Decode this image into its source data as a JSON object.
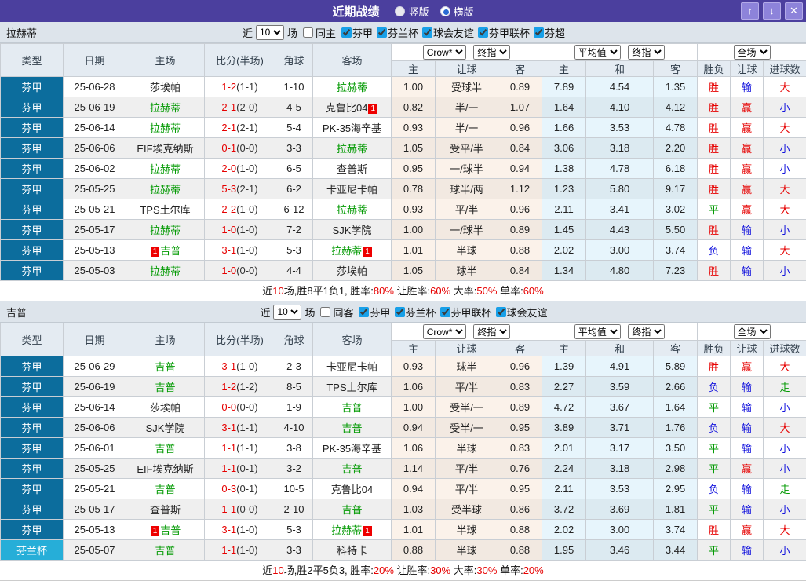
{
  "titlebar": {
    "title": "近期战绩",
    "radio_vertical": {
      "label": "竖版",
      "checked": false
    },
    "radio_horizontal": {
      "label": "横版",
      "checked": true
    },
    "buttons": {
      "up": "↑",
      "down": "↓",
      "close": "✕"
    }
  },
  "filter_labels": {
    "near": "近",
    "games": "场"
  },
  "columns": {
    "type": "类型",
    "date": "日期",
    "home": "主场",
    "score": "比分(半场)",
    "corner": "角球",
    "away": "客场",
    "sub": [
      "主",
      "让球",
      "客",
      "主",
      "和",
      "客",
      "胜负",
      "让球",
      "进球数"
    ],
    "selects": {
      "crow": "Crow*",
      "fin1": "终指",
      "avg": "平均值",
      "fin2": "终指",
      "full": "全场"
    }
  },
  "result_colors": {
    "胜": "c-r",
    "赢": "c-r",
    "大": "c-r",
    "平": "c-g",
    "走": "c-g",
    "负": "c-b",
    "输": "c-b",
    "小": "c-b"
  },
  "sections": [
    {
      "team": "拉赫蒂",
      "filter": {
        "count": "10",
        "same_label": "同主",
        "same_checked": false,
        "leagues": [
          "芬甲",
          "芬兰杯",
          "球会友谊",
          "芬甲联杯",
          "芬超"
        ]
      },
      "rows": [
        {
          "lg": "芬甲",
          "cup": false,
          "date": "25-06-28",
          "home": {
            "name": "莎埃帕"
          },
          "score": "1-2",
          "half": "(1-1)",
          "corner": "1-10",
          "away": {
            "name": "拉赫蒂",
            "green": true
          },
          "crow": [
            "1.00",
            "受球半",
            "0.89"
          ],
          "avg": [
            "7.89",
            "4.54",
            "1.35"
          ],
          "res": [
            "胜",
            "输",
            "大"
          ]
        },
        {
          "lg": "芬甲",
          "cup": false,
          "date": "25-06-19",
          "home": {
            "name": "拉赫蒂",
            "green": true
          },
          "score": "2-1",
          "half": "(2-0)",
          "corner": "4-5",
          "away": {
            "name": "克鲁比04",
            "badge_after": "1"
          },
          "crow": [
            "0.82",
            "半/一",
            "1.07"
          ],
          "avg": [
            "1.64",
            "4.10",
            "4.12"
          ],
          "res": [
            "胜",
            "赢",
            "小"
          ]
        },
        {
          "lg": "芬甲",
          "cup": false,
          "date": "25-06-14",
          "home": {
            "name": "拉赫蒂",
            "green": true
          },
          "score": "2-1",
          "half": "(2-1)",
          "corner": "5-4",
          "away": {
            "name": "PK-35海辛基"
          },
          "crow": [
            "0.93",
            "半/一",
            "0.96"
          ],
          "avg": [
            "1.66",
            "3.53",
            "4.78"
          ],
          "res": [
            "胜",
            "赢",
            "大"
          ]
        },
        {
          "lg": "芬甲",
          "cup": false,
          "date": "25-06-06",
          "home": {
            "name": "EIF埃克纳斯"
          },
          "score": "0-1",
          "half": "(0-0)",
          "corner": "3-3",
          "away": {
            "name": "拉赫蒂",
            "green": true
          },
          "crow": [
            "1.05",
            "受平/半",
            "0.84"
          ],
          "avg": [
            "3.06",
            "3.18",
            "2.20"
          ],
          "res": [
            "胜",
            "赢",
            "小"
          ]
        },
        {
          "lg": "芬甲",
          "cup": false,
          "date": "25-06-02",
          "home": {
            "name": "拉赫蒂",
            "green": true
          },
          "score": "2-0",
          "half": "(1-0)",
          "corner": "6-5",
          "away": {
            "name": "查普斯"
          },
          "crow": [
            "0.95",
            "一/球半",
            "0.94"
          ],
          "avg": [
            "1.38",
            "4.78",
            "6.18"
          ],
          "res": [
            "胜",
            "赢",
            "小"
          ]
        },
        {
          "lg": "芬甲",
          "cup": false,
          "date": "25-05-25",
          "home": {
            "name": "拉赫蒂",
            "green": true
          },
          "score": "5-3",
          "half": "(2-1)",
          "corner": "6-2",
          "away": {
            "name": "卡亚尼卡帕"
          },
          "crow": [
            "0.78",
            "球半/两",
            "1.12"
          ],
          "avg": [
            "1.23",
            "5.80",
            "9.17"
          ],
          "res": [
            "胜",
            "赢",
            "大"
          ]
        },
        {
          "lg": "芬甲",
          "cup": false,
          "date": "25-05-21",
          "home": {
            "name": "TPS土尔库"
          },
          "score": "2-2",
          "half": "(1-0)",
          "corner": "6-12",
          "away": {
            "name": "拉赫蒂",
            "green": true
          },
          "crow": [
            "0.93",
            "平/半",
            "0.96"
          ],
          "avg": [
            "2.11",
            "3.41",
            "3.02"
          ],
          "res": [
            "平",
            "赢",
            "大"
          ]
        },
        {
          "lg": "芬甲",
          "cup": false,
          "date": "25-05-17",
          "home": {
            "name": "拉赫蒂",
            "green": true
          },
          "score": "1-0",
          "half": "(1-0)",
          "corner": "7-2",
          "away": {
            "name": "SJK学院"
          },
          "crow": [
            "1.00",
            "一/球半",
            "0.89"
          ],
          "avg": [
            "1.45",
            "4.43",
            "5.50"
          ],
          "res": [
            "胜",
            "输",
            "小"
          ]
        },
        {
          "lg": "芬甲",
          "cup": false,
          "date": "25-05-13",
          "home": {
            "name": "吉普",
            "green": true,
            "badge_before": "1"
          },
          "score": "3-1",
          "half": "(1-0)",
          "corner": "5-3",
          "away": {
            "name": "拉赫蒂",
            "green": true,
            "badge_after": "1"
          },
          "crow": [
            "1.01",
            "半球",
            "0.88"
          ],
          "avg": [
            "2.02",
            "3.00",
            "3.74"
          ],
          "res": [
            "负",
            "输",
            "大"
          ]
        },
        {
          "lg": "芬甲",
          "cup": false,
          "date": "25-05-03",
          "home": {
            "name": "拉赫蒂",
            "green": true
          },
          "score": "1-0",
          "half": "(0-0)",
          "corner": "4-4",
          "away": {
            "name": "莎埃帕"
          },
          "crow": [
            "1.05",
            "球半",
            "0.84"
          ],
          "avg": [
            "1.34",
            "4.80",
            "7.23"
          ],
          "res": [
            "胜",
            "输",
            "小"
          ]
        }
      ],
      "summary": [
        {
          "t": "近"
        },
        {
          "t": "10",
          "red": true
        },
        {
          "t": "场,胜8平1负1, 胜率:"
        },
        {
          "t": "80%",
          "red": true
        },
        {
          "t": " 让胜率:"
        },
        {
          "t": "60%",
          "red": true
        },
        {
          "t": " 大率:"
        },
        {
          "t": "50%",
          "red": true
        },
        {
          "t": " 单率:"
        },
        {
          "t": "60%",
          "red": true
        }
      ]
    },
    {
      "team": "吉普",
      "filter": {
        "count": "10",
        "same_label": "同客",
        "same_checked": false,
        "leagues": [
          "芬甲",
          "芬兰杯",
          "芬甲联杯",
          "球会友谊"
        ]
      },
      "rows": [
        {
          "lg": "芬甲",
          "cup": false,
          "date": "25-06-29",
          "home": {
            "name": "吉普",
            "green": true
          },
          "score": "3-1",
          "half": "(1-0)",
          "corner": "2-3",
          "away": {
            "name": "卡亚尼卡帕"
          },
          "crow": [
            "0.93",
            "球半",
            "0.96"
          ],
          "avg": [
            "1.39",
            "4.91",
            "5.89"
          ],
          "res": [
            "胜",
            "赢",
            "大"
          ]
        },
        {
          "lg": "芬甲",
          "cup": false,
          "date": "25-06-19",
          "home": {
            "name": "吉普",
            "green": true
          },
          "score": "1-2",
          "half": "(1-2)",
          "corner": "8-5",
          "away": {
            "name": "TPS土尔库"
          },
          "crow": [
            "1.06",
            "平/半",
            "0.83"
          ],
          "avg": [
            "2.27",
            "3.59",
            "2.66"
          ],
          "res": [
            "负",
            "输",
            "走"
          ]
        },
        {
          "lg": "芬甲",
          "cup": false,
          "date": "25-06-14",
          "home": {
            "name": "莎埃帕"
          },
          "score": "0-0",
          "half": "(0-0)",
          "corner": "1-9",
          "away": {
            "name": "吉普",
            "green": true
          },
          "crow": [
            "1.00",
            "受半/一",
            "0.89"
          ],
          "avg": [
            "4.72",
            "3.67",
            "1.64"
          ],
          "res": [
            "平",
            "输",
            "小"
          ]
        },
        {
          "lg": "芬甲",
          "cup": false,
          "date": "25-06-06",
          "home": {
            "name": "SJK学院"
          },
          "score": "3-1",
          "half": "(1-1)",
          "corner": "4-10",
          "away": {
            "name": "吉普",
            "green": true
          },
          "crow": [
            "0.94",
            "受半/一",
            "0.95"
          ],
          "avg": [
            "3.89",
            "3.71",
            "1.76"
          ],
          "res": [
            "负",
            "输",
            "大"
          ]
        },
        {
          "lg": "芬甲",
          "cup": false,
          "date": "25-06-01",
          "home": {
            "name": "吉普",
            "green": true
          },
          "score": "1-1",
          "half": "(1-1)",
          "corner": "3-8",
          "away": {
            "name": "PK-35海辛基"
          },
          "crow": [
            "1.06",
            "半球",
            "0.83"
          ],
          "avg": [
            "2.01",
            "3.17",
            "3.50"
          ],
          "res": [
            "平",
            "输",
            "小"
          ]
        },
        {
          "lg": "芬甲",
          "cup": false,
          "date": "25-05-25",
          "home": {
            "name": "EIF埃克纳斯"
          },
          "score": "1-1",
          "half": "(0-1)",
          "corner": "3-2",
          "away": {
            "name": "吉普",
            "green": true
          },
          "crow": [
            "1.14",
            "平/半",
            "0.76"
          ],
          "avg": [
            "2.24",
            "3.18",
            "2.98"
          ],
          "res": [
            "平",
            "赢",
            "小"
          ]
        },
        {
          "lg": "芬甲",
          "cup": false,
          "date": "25-05-21",
          "home": {
            "name": "吉普",
            "green": true
          },
          "score": "0-3",
          "half": "(0-1)",
          "corner": "10-5",
          "away": {
            "name": "克鲁比04"
          },
          "crow": [
            "0.94",
            "平/半",
            "0.95"
          ],
          "avg": [
            "2.11",
            "3.53",
            "2.95"
          ],
          "res": [
            "负",
            "输",
            "走"
          ]
        },
        {
          "lg": "芬甲",
          "cup": false,
          "date": "25-05-17",
          "home": {
            "name": "查普斯"
          },
          "score": "1-1",
          "half": "(0-0)",
          "corner": "2-10",
          "away": {
            "name": "吉普",
            "green": true
          },
          "crow": [
            "1.03",
            "受半球",
            "0.86"
          ],
          "avg": [
            "3.72",
            "3.69",
            "1.81"
          ],
          "res": [
            "平",
            "输",
            "小"
          ]
        },
        {
          "lg": "芬甲",
          "cup": false,
          "date": "25-05-13",
          "home": {
            "name": "吉普",
            "green": true,
            "badge_before": "1"
          },
          "score": "3-1",
          "half": "(1-0)",
          "corner": "5-3",
          "away": {
            "name": "拉赫蒂",
            "green": true,
            "badge_after": "1"
          },
          "crow": [
            "1.01",
            "半球",
            "0.88"
          ],
          "avg": [
            "2.02",
            "3.00",
            "3.74"
          ],
          "res": [
            "胜",
            "赢",
            "大"
          ]
        },
        {
          "lg": "芬兰杯",
          "cup": true,
          "date": "25-05-07",
          "home": {
            "name": "吉普",
            "green": true
          },
          "score": "1-1",
          "half": "(1-0)",
          "corner": "3-3",
          "away": {
            "name": "科特卡"
          },
          "crow": [
            "0.88",
            "半球",
            "0.88"
          ],
          "avg": [
            "1.95",
            "3.46",
            "3.44"
          ],
          "res": [
            "平",
            "输",
            "小"
          ]
        }
      ],
      "summary": [
        {
          "t": "近"
        },
        {
          "t": "10",
          "red": true
        },
        {
          "t": "场,胜2平5负3, 胜率:"
        },
        {
          "t": "20%",
          "red": true
        },
        {
          "t": " 让胜率:"
        },
        {
          "t": "30%",
          "red": true
        },
        {
          "t": " 大率:"
        },
        {
          "t": "30%",
          "red": true
        },
        {
          "t": " 单率:"
        },
        {
          "t": "20%",
          "red": true
        }
      ]
    }
  ]
}
